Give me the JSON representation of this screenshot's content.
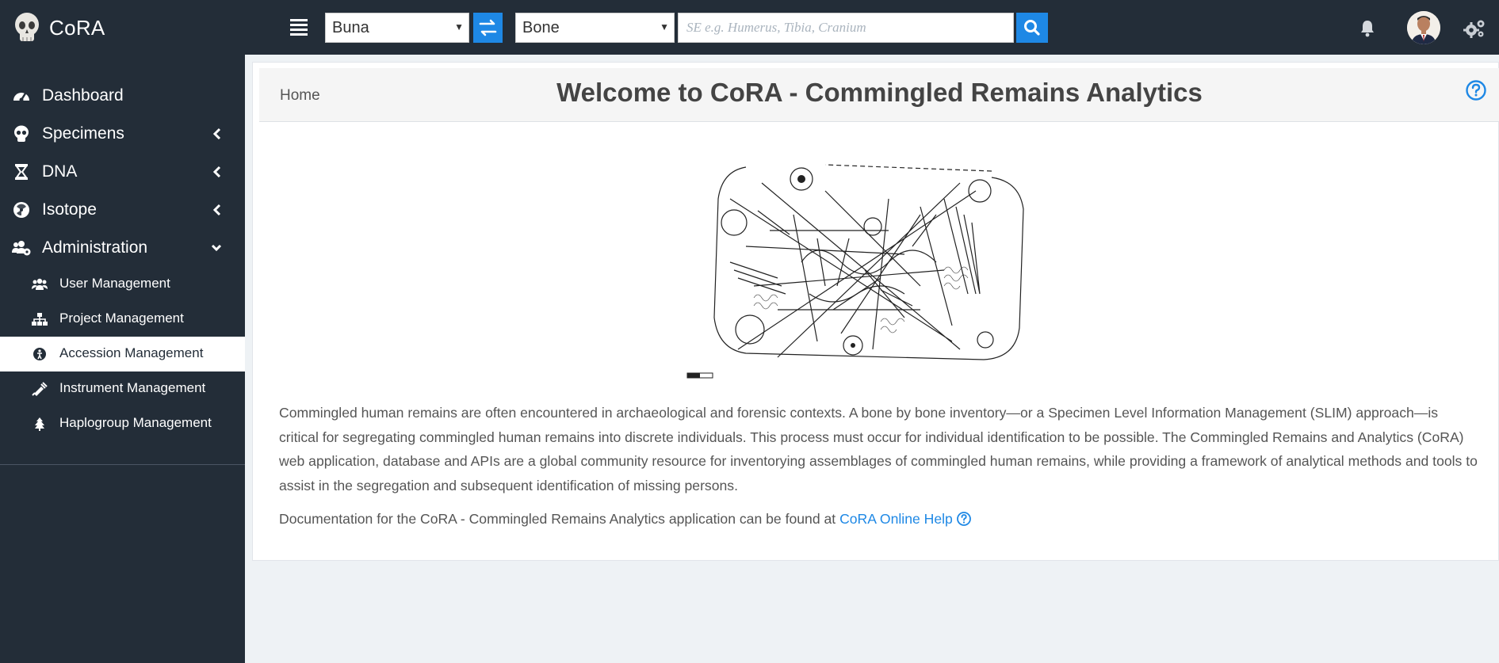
{
  "app": {
    "name": "CoRA",
    "logo_icon": "skull-icon"
  },
  "header": {
    "menu_icon": "hamburger-icon",
    "project_select": {
      "value": "Buna"
    },
    "swap_icon": "swap-arrows-icon",
    "category_select": {
      "value": "Bone"
    },
    "search": {
      "placeholder": "SE e.g. Humerus, Tibia, Cranium",
      "value": ""
    },
    "search_icon": "search-icon",
    "notification_icon": "bell-icon",
    "settings_icon": "gears-icon"
  },
  "sidebar": {
    "items": [
      {
        "label": "Dashboard",
        "icon": "dashboard-gauge-icon"
      },
      {
        "label": "Specimens",
        "icon": "skull-icon",
        "chevron": "chevron-left-icon"
      },
      {
        "label": "DNA",
        "icon": "hourglass-icon",
        "chevron": "chevron-left-icon"
      },
      {
        "label": "Isotope",
        "icon": "radiation-icon",
        "chevron": "chevron-left-icon"
      },
      {
        "label": "Administration",
        "icon": "users-cog-icon",
        "chevron": "chevron-down-icon"
      }
    ],
    "subitems": [
      {
        "label": "User Management",
        "icon": "users-icon"
      },
      {
        "label": "Project Management",
        "icon": "sitemap-icon"
      },
      {
        "label": "Accession Management",
        "icon": "accession-icon",
        "active": true
      },
      {
        "label": "Instrument Management",
        "icon": "syringe-icon"
      },
      {
        "label": "Haplogroup Management",
        "icon": "tree-icon"
      }
    ]
  },
  "main": {
    "breadcrumb": "Home",
    "title": "Welcome to CoRA - Commingled Remains Analytics",
    "help_icon": "question-circle-icon",
    "description": "Commingled human remains are often encountered in archaeological and forensic contexts. A bone by bone inventory—or a Specimen Level Information Management (SLIM) approach—is critical for segregating commingled human remains into discrete individuals. This process must occur for individual identification to be possible. The Commingled Remains and Analytics (CoRA) web application, database and APIs are a global community resource for inventorying assemblages of commingled human remains, while providing a framework of analytical methods and tools to assist in the segregation and subsequent identification of missing persons.",
    "doc_text": "Documentation for the CoRA - Commingled Remains Analytics application can be found at ",
    "doc_link": "CoRA Online Help",
    "accent_color": "#1e88e5",
    "sidebar_color": "#232d38"
  }
}
